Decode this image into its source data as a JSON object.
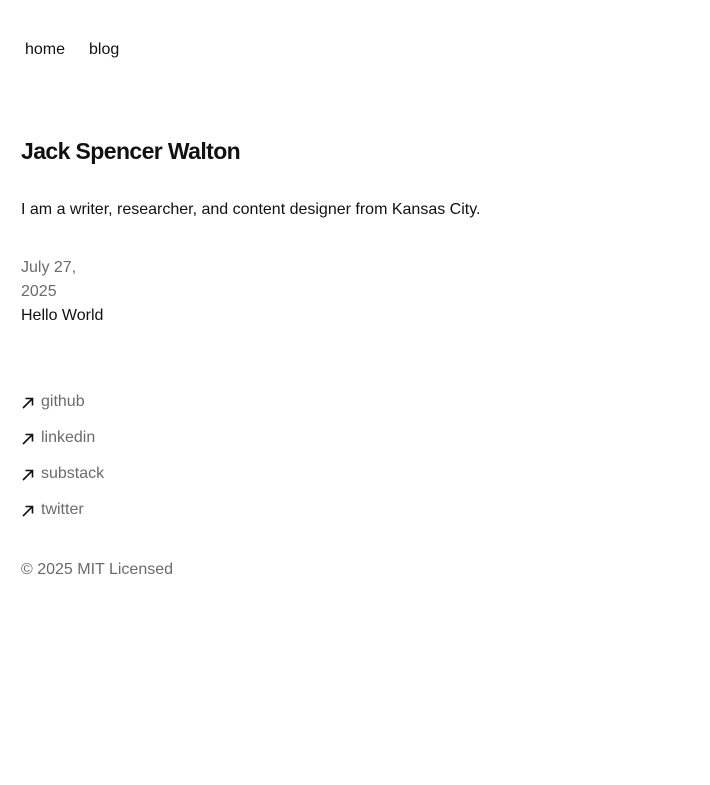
{
  "nav": {
    "home": "home",
    "blog": "blog"
  },
  "profile": {
    "name": "Jack Spencer Walton",
    "bio": "I am a writer, researcher, and content designer from Kansas City."
  },
  "posts": [
    {
      "date": "July 27, 2025",
      "title": "Hello World"
    }
  ],
  "social": [
    {
      "label": "github",
      "icon": "arrow-up-right-icon"
    },
    {
      "label": "linkedin",
      "icon": "arrow-up-right-icon"
    },
    {
      "label": "substack",
      "icon": "arrow-up-right-icon"
    },
    {
      "label": "twitter",
      "icon": "arrow-up-right-icon"
    }
  ],
  "footer": {
    "text": "© 2025 MIT Licensed"
  },
  "colors": {
    "text": "#111111",
    "muted": "#6b6b6b",
    "background": "#ffffff"
  }
}
